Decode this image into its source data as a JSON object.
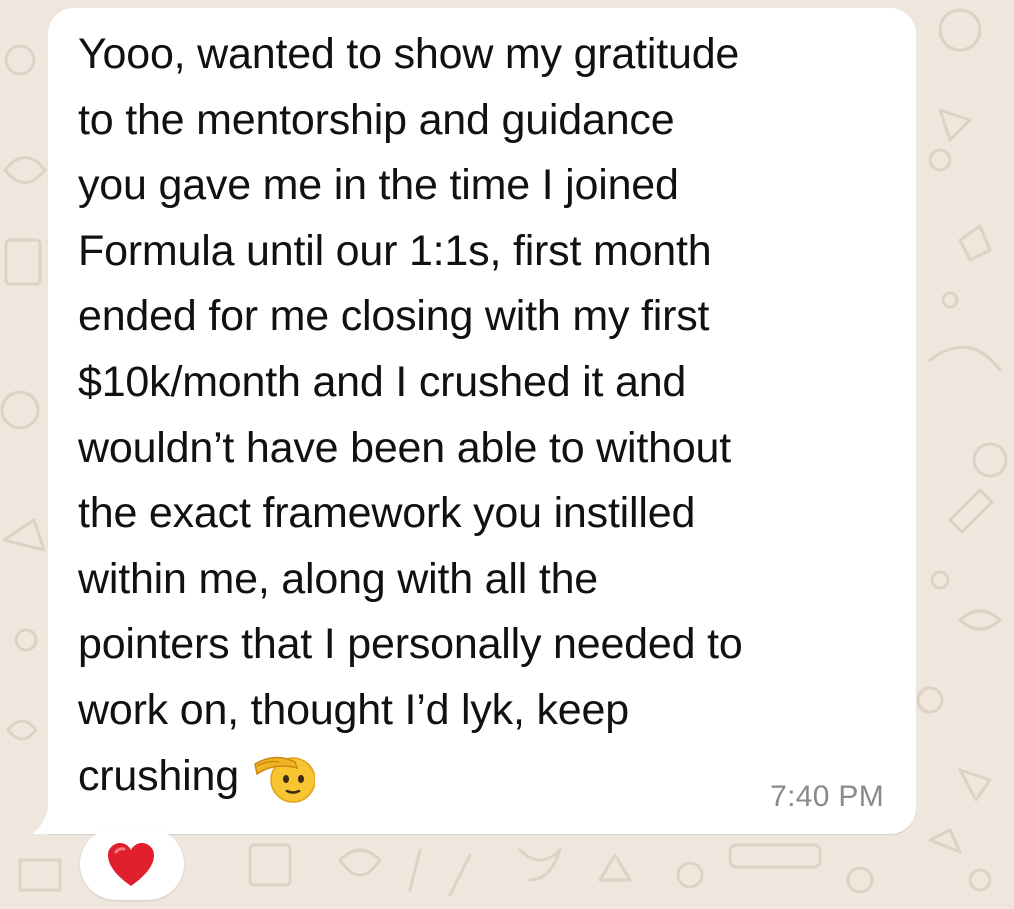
{
  "message": {
    "text": "Yooo, wanted to show my gratitude\nto the mentorship and guidance\nyou gave me in the time I joined\nFormula until our 1:1s, first month\nended for me closing with my first\n$10k/month and I crushed it and\nwouldn’t have been able to without\nthe exact framework you instilled\nwithin me, along with all the\npointers that I personally needed to\nwork on, thought I’d lyk, keep\ncrushing",
    "emoji": "saluting-face",
    "time": "7:40 PM"
  },
  "reaction": {
    "emoji": "red-heart",
    "color": "#e0202c"
  },
  "theme": {
    "wallpaper_color": "#efe7dd",
    "bubble_color": "#ffffff",
    "text_color": "#111111",
    "time_color": "#8a8a8a"
  }
}
